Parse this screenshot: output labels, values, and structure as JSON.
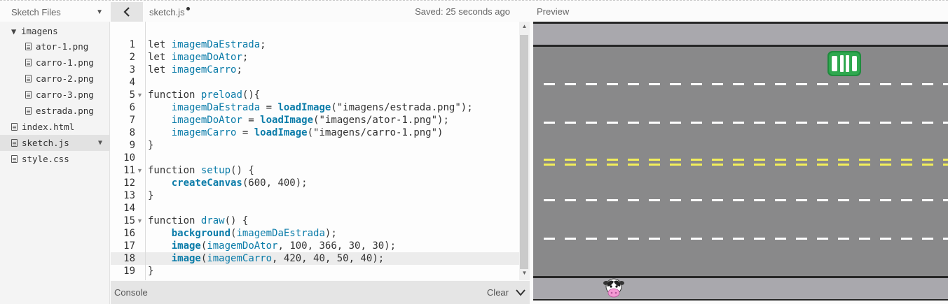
{
  "sidebar": {
    "title": "Sketch Files",
    "folder": "imagens",
    "images": [
      "ator-1.png",
      "carro-1.png",
      "carro-2.png",
      "carro-3.png",
      "estrada.png"
    ],
    "files": [
      "index.html",
      "sketch.js",
      "style.css"
    ],
    "selected_file": "sketch.js"
  },
  "editor": {
    "filename": "sketch.js",
    "save_status": "Saved: 25 seconds ago",
    "active_line": 18,
    "lines": [
      "let imagemDaEstrada;",
      "let imagemDoAtor;",
      "let imagemCarro;",
      "",
      "function preload(){",
      "    imagemDaEstrada = loadImage(\"imagens/estrada.png\");",
      "    imagemDoAtor = loadImage(\"imagens/ator-1.png\");",
      "    imagemCarro = loadImage(\"imagens/carro-1.png\")",
      "}",
      "",
      "function setup() {",
      "    createCanvas(600, 400);",
      "}",
      "",
      "function draw() {",
      "    background(imagemDaEstrada);",
      "    image(imagemDoAtor, 100, 366, 30, 30);",
      "    image(imagemCarro, 420, 40, 50, 40);",
      "}"
    ],
    "fold_lines": [
      5,
      11,
      15
    ]
  },
  "console": {
    "label": "Console",
    "clear_label": "Clear"
  },
  "preview": {
    "label": "Preview",
    "colors": {
      "road": "#89898a",
      "sidewalk": "#a9a8ad",
      "curb": "#262626",
      "white_lane": "#ffffff",
      "yellow_lane": "#f2ee5a",
      "car_green": "#2fa84f"
    }
  }
}
